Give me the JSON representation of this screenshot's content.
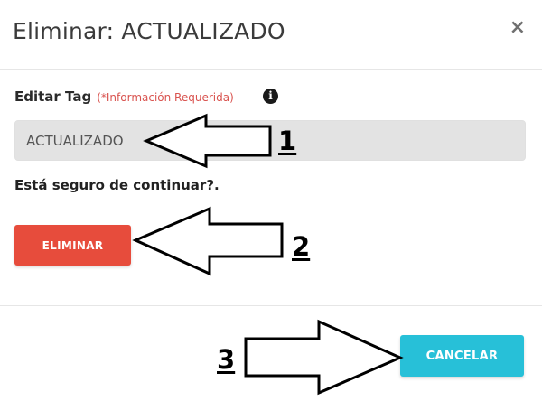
{
  "dialog": {
    "title": "Eliminar: ACTUALIZADO",
    "close_symbol": "×",
    "field_label": "Editar Tag",
    "required_note": "(*Información Requerida)",
    "info_symbol": "i",
    "tag_value": "ACTUALIZADO",
    "confirm_text": "Está seguro de continuar?.",
    "delete_label": "ELIMINAR",
    "cancel_label": "CANCELAR"
  },
  "annotations": {
    "marker_1": "1",
    "marker_2": "2",
    "marker_3": "3"
  },
  "colors": {
    "delete_button": "#e74c3c",
    "cancel_button": "#27c0d8",
    "required_note": "#d9534f",
    "input_background": "#e3e3e3"
  },
  "icons": {
    "close": "close-icon",
    "info": "info-icon",
    "arrows": "arrow-icon"
  }
}
